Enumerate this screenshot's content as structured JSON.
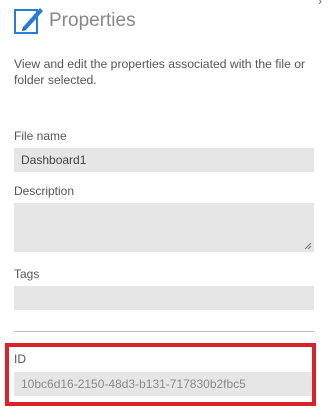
{
  "header": {
    "title": "Properties",
    "icon": "pencil-edit-icon"
  },
  "description": "View and edit the properties associated with the file or folder selected.",
  "fields": {
    "file_name": {
      "label": "File name",
      "value": "Dashboard1"
    },
    "description": {
      "label": "Description",
      "value": ""
    },
    "tags": {
      "label": "Tags",
      "value": ""
    },
    "id": {
      "label": "ID",
      "value": "10bc6d16-2150-48d3-b131-717830b2fbc5"
    }
  },
  "colors": {
    "highlight": "#d8232a",
    "field_background": "#e6e6e6",
    "icon_blue": "#2a7bd3"
  }
}
